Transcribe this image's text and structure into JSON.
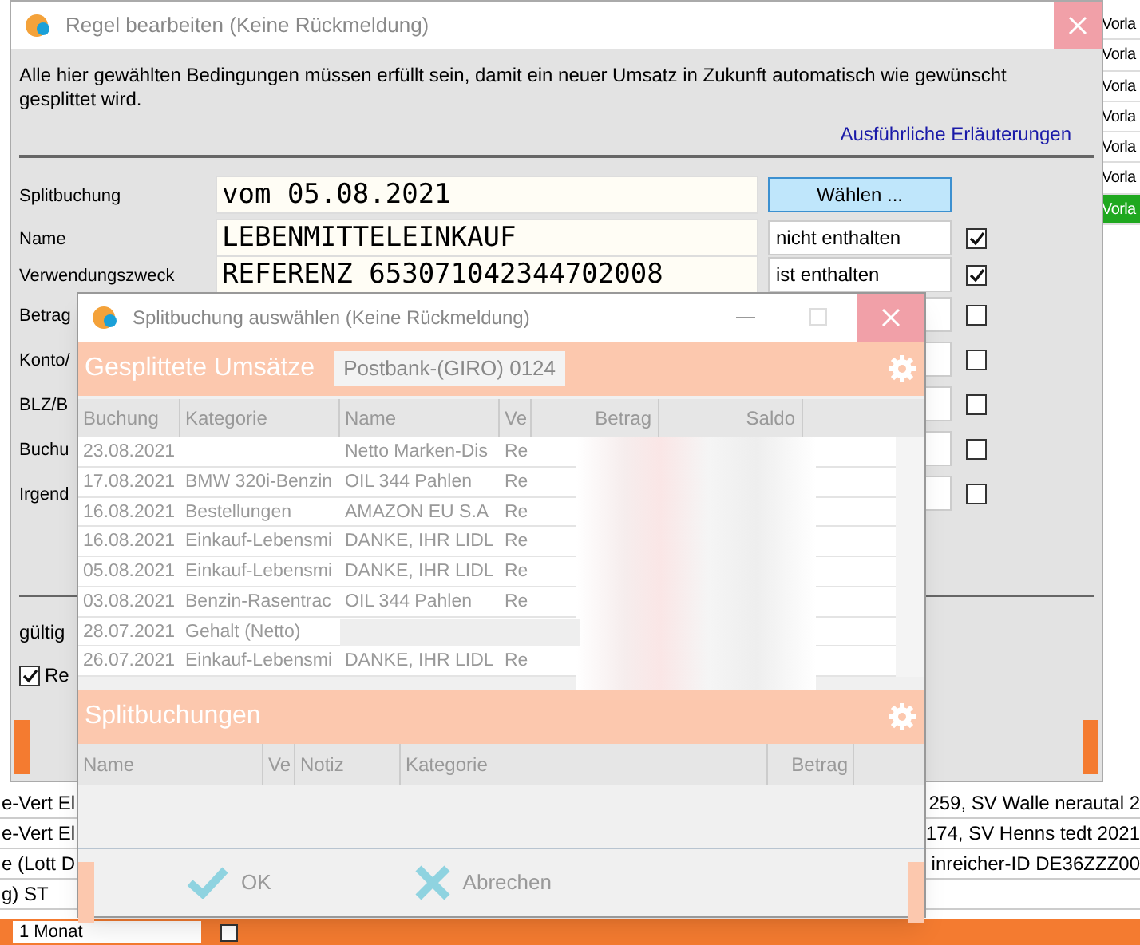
{
  "background_app": {
    "right_column": [
      {
        "text": "Vorla",
        "selected": false
      },
      {
        "text": "Vorla",
        "selected": false
      },
      {
        "text": "Vorla",
        "selected": false
      },
      {
        "text": "Vorla",
        "selected": false
      },
      {
        "text": "Vorla",
        "selected": false
      },
      {
        "text": "Vorla",
        "selected": false
      },
      {
        "text": "Vorla",
        "selected": true
      }
    ],
    "bottom_rows": [
      {
        "left": "e-Vert El",
        "right": "259,  SV Walle nerautal 2"
      },
      {
        "left": "e-Vert El",
        "right": "174,  SV Henns tedt 2021"
      },
      {
        "left": "e (Lott D",
        "right": "inreicher-ID DE36ZZZ00"
      },
      {
        "left": "g)    ST",
        "right": ""
      }
    ],
    "period": "1 Monat",
    "period_option_checked": false
  },
  "rule_dialog": {
    "title": "Regel bearbeiten (Keine Rückmeldung)",
    "intro": "Alle hier gewählten Bedingungen müssen erfüllt sein, damit ein neuer Umsatz in Zukunft automatisch wie gewünscht gesplittet wird.",
    "link": "Ausführliche Erläuterungen",
    "fields": [
      {
        "kind": "split",
        "label": "Splitbuchung",
        "value": "vom 05.08.2021",
        "button": "Wählen ..."
      },
      {
        "kind": "condition",
        "label": "Name",
        "value": "LEBENMITTELEINKAUF",
        "operator": "nicht enthalten",
        "checked": true
      },
      {
        "kind": "condition",
        "label": "Verwendungszweck",
        "value": "REFERENZ 653071042344702008",
        "operator": "ist enthalten",
        "checked": true
      },
      {
        "kind": "condition",
        "label": "Betrag",
        "checked": false
      },
      {
        "kind": "condition",
        "label": "Konto/",
        "checked": false
      },
      {
        "kind": "condition",
        "label": "BLZ/B",
        "checked": false
      },
      {
        "kind": "condition",
        "label": "Buchu",
        "checked": false
      },
      {
        "kind": "condition",
        "label": "Irgend",
        "checked": false
      }
    ],
    "validity_label": "gültig",
    "option": {
      "label": "Re",
      "checked": true
    }
  },
  "split_dialog": {
    "title": "Splitbuchung auswählen (Keine Rückmeldung)",
    "section_title": "Gesplittete Umsätze",
    "account": "Postbank-(GIRO) 0124",
    "columns": [
      "Buchung",
      "Kategorie",
      "Name",
      "Ve",
      "Betrag",
      "Saldo"
    ],
    "rows": [
      [
        "23.08.2021",
        "",
        "Netto Marken-Dis",
        "Re"
      ],
      [
        "17.08.2021",
        "BMW 320i-Benzin",
        "OIL 344 Pahlen",
        "Re"
      ],
      [
        "16.08.2021",
        "Bestellungen",
        "AMAZON EU S.A",
        "Re"
      ],
      [
        "16.08.2021",
        "Einkauf-Lebensmi",
        "DANKE, IHR LIDL",
        "Re"
      ],
      [
        "05.08.2021",
        "Einkauf-Lebensmi",
        "DANKE, IHR LIDL",
        "Re"
      ],
      [
        "03.08.2021",
        "Benzin-Rasentrac",
        "OIL 344 Pahlen",
        "Re"
      ],
      [
        "28.07.2021",
        "Gehalt (Netto)",
        "",
        ""
      ],
      [
        "26.07.2021",
        "Einkauf-Lebensmi",
        "DANKE, IHR LIDL",
        "Re"
      ]
    ],
    "split_title": "Splitbuchungen",
    "split_columns": [
      "Name",
      "Ve",
      "Notiz",
      "Kategorie",
      "Betrag"
    ],
    "ok": "OK",
    "cancel": "Abrechen"
  }
}
